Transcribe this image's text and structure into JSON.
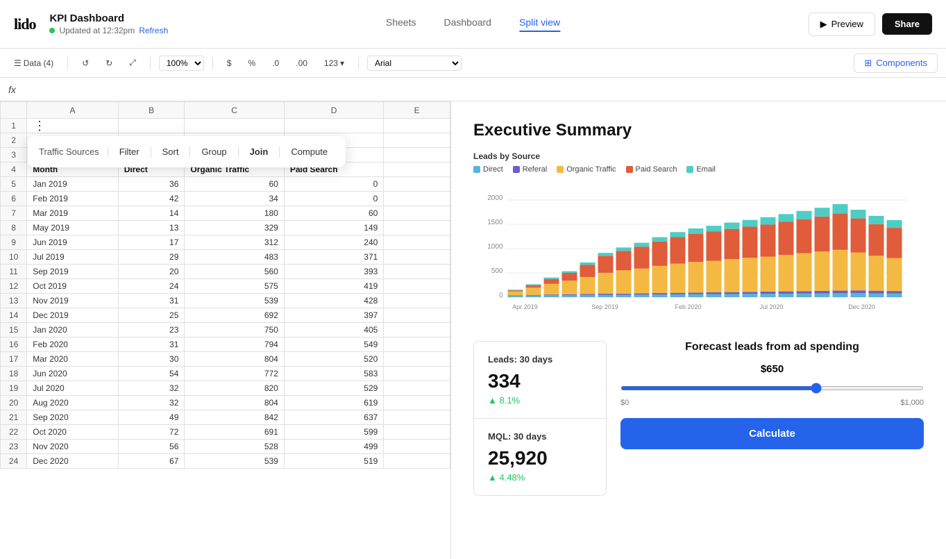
{
  "header": {
    "logo": "lido",
    "title": "KPI Dashboard",
    "status": "Updated at 12:32pm",
    "refresh": "Refresh",
    "nav_tabs": [
      {
        "id": "sheets",
        "label": "Sheets"
      },
      {
        "id": "dashboard",
        "label": "Dashboard"
      },
      {
        "id": "split_view",
        "label": "Split view",
        "active": true
      }
    ],
    "preview_label": "Preview",
    "share_label": "Share"
  },
  "toolbar": {
    "data_label": "Data (4)",
    "zoom_value": "100%",
    "currency_label": "$",
    "percent_label": "%",
    "decimal_down": ".0",
    "decimal_up": ".00",
    "format_label": "123",
    "font_label": "Arial",
    "components_label": "Components"
  },
  "formula_bar": {
    "fx_label": "fx"
  },
  "spreadsheet": {
    "col_headers": [
      "",
      "A",
      "B",
      "C",
      "D",
      "E"
    ],
    "context_menu": {
      "table_name": "Traffic Sources",
      "items": [
        "Filter",
        "Sort",
        "Group",
        "Join",
        "Compute"
      ]
    },
    "rows": [
      {
        "row": 1,
        "a": "",
        "b": "",
        "c": "",
        "d": "",
        "e": ""
      },
      {
        "row": 2,
        "a": "",
        "b": "",
        "c": "",
        "d": "",
        "e": ""
      },
      {
        "row": 3,
        "a": "",
        "b": "",
        "c": "",
        "d": "",
        "e": ""
      },
      {
        "row": 4,
        "a": "Month",
        "b": "Direct",
        "c": "Organic Traffic",
        "d": "Paid Search",
        "e": "",
        "is_header": true
      },
      {
        "row": 5,
        "a": "Jan 2019",
        "b": "36",
        "c": "60",
        "d": "0",
        "e": ""
      },
      {
        "row": 6,
        "a": "Feb 2019",
        "b": "42",
        "c": "34",
        "d": "0",
        "e": ""
      },
      {
        "row": 7,
        "a": "Mar 2019",
        "b": "14",
        "c": "180",
        "d": "60",
        "e": ""
      },
      {
        "row": 8,
        "a": "May 2019",
        "b": "13",
        "c": "329",
        "d": "149",
        "e": ""
      },
      {
        "row": 9,
        "a": "Jun 2019",
        "b": "17",
        "c": "312",
        "d": "240",
        "e": ""
      },
      {
        "row": 10,
        "a": "Jul 2019",
        "b": "29",
        "c": "483",
        "d": "371",
        "e": ""
      },
      {
        "row": 11,
        "a": "Sep 2019",
        "b": "20",
        "c": "560",
        "d": "393",
        "e": ""
      },
      {
        "row": 12,
        "a": "Oct 2019",
        "b": "24",
        "c": "575",
        "d": "419",
        "e": ""
      },
      {
        "row": 13,
        "a": "Nov 2019",
        "b": "31",
        "c": "539",
        "d": "428",
        "e": ""
      },
      {
        "row": 14,
        "a": "Dec 2019",
        "b": "25",
        "c": "692",
        "d": "397",
        "e": ""
      },
      {
        "row": 15,
        "a": "Jan 2020",
        "b": "23",
        "c": "750",
        "d": "405",
        "e": ""
      },
      {
        "row": 16,
        "a": "Feb 2020",
        "b": "31",
        "c": "794",
        "d": "549",
        "e": ""
      },
      {
        "row": 17,
        "a": "Mar 2020",
        "b": "30",
        "c": "804",
        "d": "520",
        "e": ""
      },
      {
        "row": 18,
        "a": "Jun 2020",
        "b": "54",
        "c": "772",
        "d": "583",
        "e": ""
      },
      {
        "row": 19,
        "a": "Jul 2020",
        "b": "32",
        "c": "820",
        "d": "529",
        "e": ""
      },
      {
        "row": 20,
        "a": "Aug 2020",
        "b": "32",
        "c": "804",
        "d": "619",
        "e": ""
      },
      {
        "row": 21,
        "a": "Sep 2020",
        "b": "49",
        "c": "842",
        "d": "637",
        "e": ""
      },
      {
        "row": 22,
        "a": "Oct 2020",
        "b": "72",
        "c": "691",
        "d": "599",
        "e": ""
      },
      {
        "row": 23,
        "a": "Nov 2020",
        "b": "56",
        "c": "528",
        "d": "499",
        "e": ""
      },
      {
        "row": 24,
        "a": "Dec 2020",
        "b": "67",
        "c": "539",
        "d": "519",
        "e": ""
      }
    ]
  },
  "dashboard": {
    "title": "Executive Summary",
    "chart": {
      "title": "Leads by Source",
      "legend": [
        {
          "label": "Direct",
          "color": "#5ab4d6"
        },
        {
          "label": "Referal",
          "color": "#6c5fc7"
        },
        {
          "label": "Organic Traffic",
          "color": "#f4b942"
        },
        {
          "label": "Paid Search",
          "color": "#e05c3a"
        },
        {
          "label": "Email",
          "color": "#4ecdc4"
        }
      ],
      "y_labels": [
        "0",
        "500",
        "1000",
        "1500",
        "2000"
      ],
      "x_labels": [
        "Apr 2019",
        "Sep 2019",
        "Feb 2020",
        "Jul 2020",
        "Dec 2020"
      ],
      "bars": [
        {
          "x": 0,
          "direct": 30,
          "referal": 10,
          "organic": 80,
          "paid": 20,
          "email": 15
        },
        {
          "x": 1,
          "direct": 35,
          "referal": 12,
          "organic": 150,
          "paid": 50,
          "email": 20
        },
        {
          "x": 2,
          "direct": 40,
          "referal": 15,
          "organic": 220,
          "paid": 100,
          "email": 30
        },
        {
          "x": 3,
          "direct": 42,
          "referal": 18,
          "organic": 280,
          "paid": 160,
          "email": 35
        },
        {
          "x": 4,
          "direct": 45,
          "referal": 20,
          "organic": 350,
          "paid": 250,
          "email": 50
        },
        {
          "x": 5,
          "direct": 50,
          "referal": 22,
          "organic": 430,
          "paid": 350,
          "email": 60
        },
        {
          "x": 6,
          "direct": 48,
          "referal": 25,
          "organic": 480,
          "paid": 400,
          "email": 70
        },
        {
          "x": 7,
          "direct": 52,
          "referal": 28,
          "organic": 510,
          "paid": 450,
          "email": 80
        },
        {
          "x": 8,
          "direct": 55,
          "referal": 30,
          "organic": 560,
          "paid": 500,
          "email": 90
        },
        {
          "x": 9,
          "direct": 58,
          "referal": 32,
          "organic": 600,
          "paid": 550,
          "email": 100
        },
        {
          "x": 10,
          "direct": 60,
          "referal": 35,
          "organic": 630,
          "paid": 580,
          "email": 110
        },
        {
          "x": 11,
          "direct": 62,
          "referal": 38,
          "organic": 650,
          "paid": 600,
          "email": 120
        },
        {
          "x": 12,
          "direct": 65,
          "referal": 40,
          "organic": 680,
          "paid": 620,
          "email": 130
        },
        {
          "x": 13,
          "direct": 68,
          "referal": 42,
          "organic": 700,
          "paid": 640,
          "email": 140
        },
        {
          "x": 14,
          "direct": 70,
          "referal": 45,
          "organic": 720,
          "paid": 660,
          "email": 150
        },
        {
          "x": 15,
          "direct": 72,
          "referal": 48,
          "organic": 750,
          "paid": 680,
          "email": 160
        },
        {
          "x": 16,
          "direct": 75,
          "referal": 50,
          "organic": 780,
          "paid": 700,
          "email": 170
        },
        {
          "x": 17,
          "direct": 78,
          "referal": 52,
          "organic": 810,
          "paid": 720,
          "email": 180
        },
        {
          "x": 18,
          "direct": 80,
          "referal": 55,
          "organic": 840,
          "paid": 750,
          "email": 190
        },
        {
          "x": 19,
          "direct": 82,
          "referal": 58,
          "organic": 780,
          "paid": 700,
          "email": 180
        },
        {
          "x": 20,
          "direct": 78,
          "referal": 55,
          "organic": 720,
          "paid": 650,
          "email": 170
        },
        {
          "x": 21,
          "direct": 75,
          "referal": 52,
          "organic": 680,
          "paid": 620,
          "email": 160
        }
      ]
    },
    "kpi_cards": [
      {
        "label": "Leads: 30 days",
        "value": "334",
        "change": "▲ 8.1%",
        "change_color": "#22c55e"
      },
      {
        "label": "MQL: 30 days",
        "value": "25,920",
        "change": "▲ 4.48%",
        "change_color": "#22c55e"
      }
    ],
    "forecast": {
      "title": "Forecast leads from ad spending",
      "amount": "$650",
      "slider_min": "$0",
      "slider_max": "$1,000",
      "calculate_label": "Calculate"
    }
  }
}
